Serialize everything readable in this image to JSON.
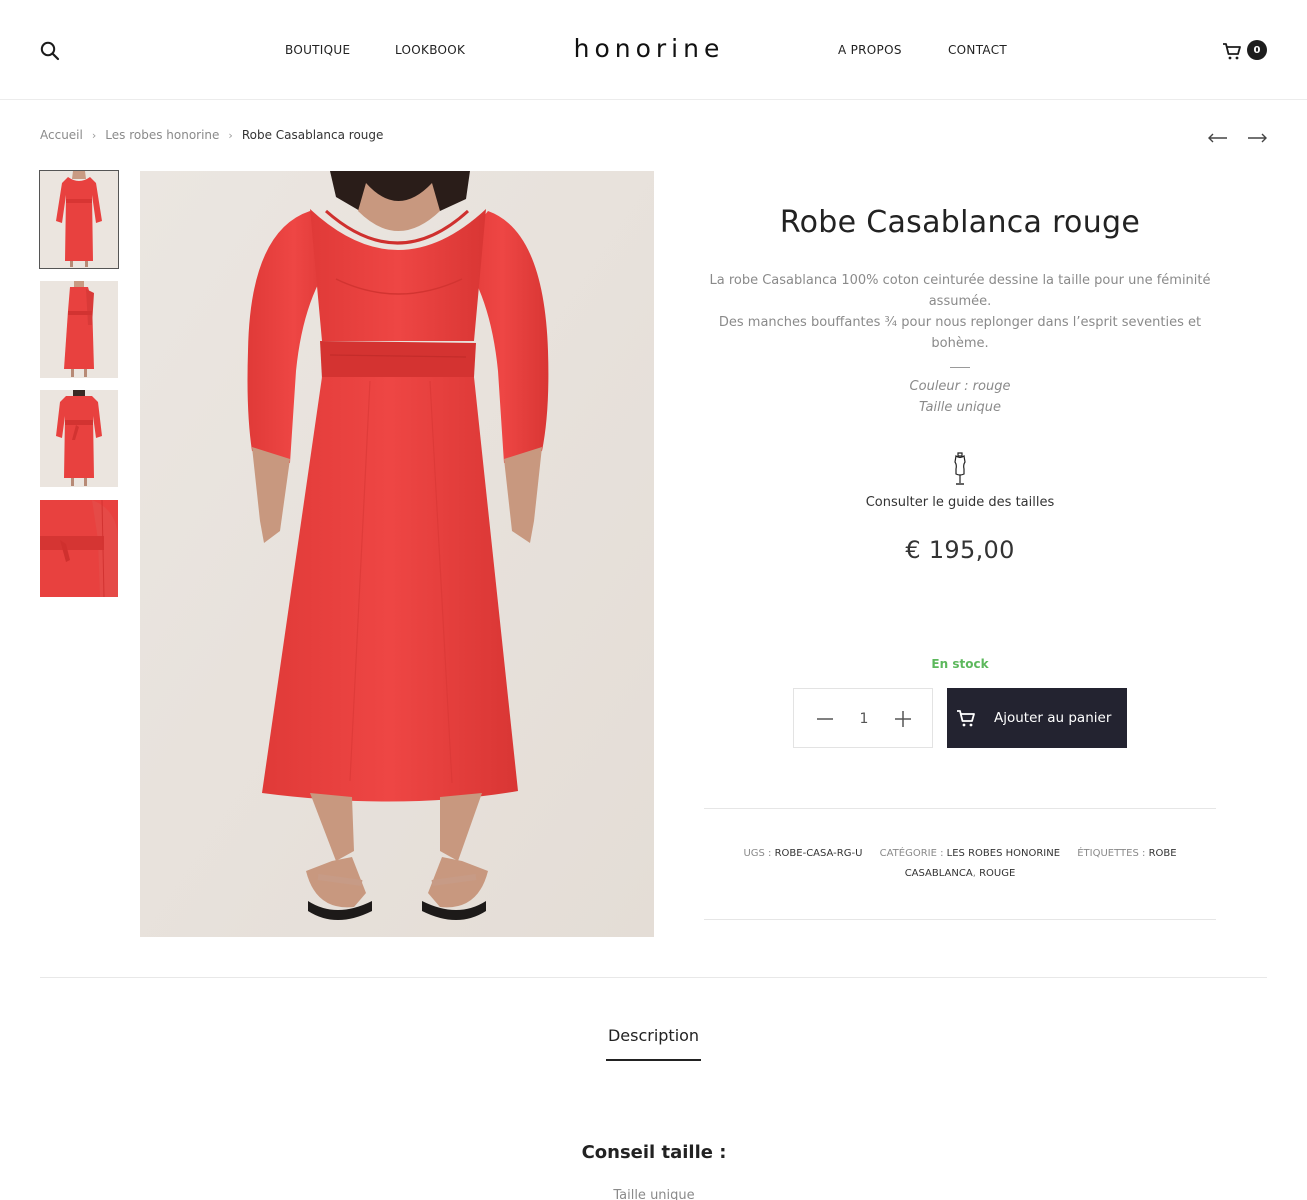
{
  "header": {
    "logo": "honorine",
    "nav_left": [
      "BOUTIQUE",
      "LOOKBOOK"
    ],
    "nav_right": [
      "A PROPOS",
      "CONTACT"
    ],
    "cart_count": "0"
  },
  "breadcrumb": {
    "items": [
      "Accueil",
      "Les robes honorine",
      "Robe Casablanca rouge"
    ],
    "separator": "›"
  },
  "gallery": {
    "thumbnail_count": 4,
    "active_thumbnail": 1
  },
  "product": {
    "title": "Robe Casablanca rouge",
    "description_1": "La robe Casablanca 100% coton ceinturée dessine la taille pour une féminité assumée.",
    "description_2": "Des manches bouffantes ¾ pour nous replonger dans l’esprit seventies et bohème.",
    "color_attr": "Couleur : rouge",
    "size_attr": "Taille unique",
    "size_guide": "Consulter le guide des tailles",
    "price": "€ 195,00",
    "stock": "En stock",
    "quantity": "1",
    "add_to_cart": "Ajouter au panier"
  },
  "meta": {
    "sku_label": "UGS :",
    "sku": "ROBE-CASA-RG-U",
    "category_label": "CATÉGORIE :",
    "category": "LES ROBES HONORINE",
    "tags_label": "ÉTIQUETTES :",
    "tag_1": "ROBE CASABLANCA",
    "tag_2": "ROUGE"
  },
  "tabs": {
    "items": [
      "Description"
    ]
  },
  "description_section": {
    "title": "Conseil taille :",
    "text": "Taille unique"
  },
  "colors": {
    "dress_red": "#e8413f",
    "dark_button": "#232330",
    "stock_green": "#5cb85c",
    "muted_text": "#8a8a8a"
  },
  "icons": {
    "search": "search-icon",
    "cart": "cart-icon",
    "prev": "arrow-left-icon",
    "next": "arrow-right-icon",
    "size_guide": "dress-form-icon",
    "minus": "minus-icon",
    "plus": "plus-icon"
  }
}
